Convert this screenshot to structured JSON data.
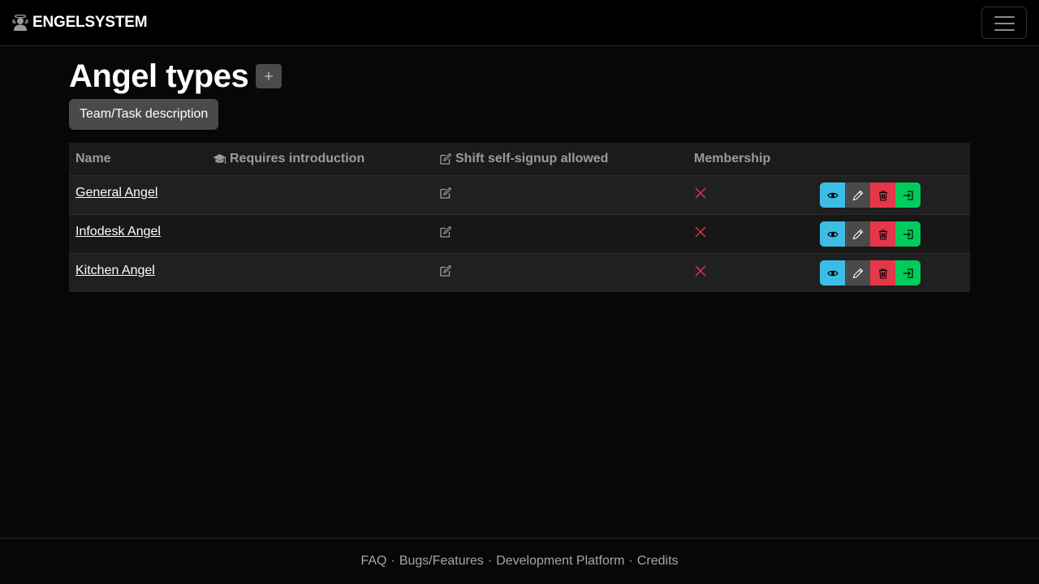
{
  "brand": {
    "name": "ENGELSYSTEM",
    "icon": "angel-icon"
  },
  "nav": {
    "toggler_icon": "hamburger-icon"
  },
  "page": {
    "title": "Angel types",
    "add_icon": "plus-icon",
    "description_button": "Team/Task description"
  },
  "table": {
    "columns": [
      {
        "label": "Name",
        "icon": ""
      },
      {
        "label": "Requires introduction",
        "icon": "graduation-cap-icon"
      },
      {
        "label": "Shift self-signup allowed",
        "icon": "pencil-square-icon"
      },
      {
        "label": "Membership",
        "icon": ""
      }
    ],
    "rows": [
      {
        "name": "General Angel",
        "requires_introduction": "",
        "self_signup_icon": "pencil-square-icon",
        "membership_icon": "x-icon"
      },
      {
        "name": "Infodesk Angel",
        "requires_introduction": "",
        "self_signup_icon": "pencil-square-icon",
        "membership_icon": "x-icon"
      },
      {
        "name": "Kitchen Angel",
        "requires_introduction": "",
        "self_signup_icon": "pencil-square-icon",
        "membership_icon": "x-icon"
      }
    ],
    "actions": [
      "eye-icon",
      "pencil-icon",
      "trash-icon",
      "sign-in-icon"
    ]
  },
  "footer": {
    "links": [
      "FAQ",
      "Bugs/Features",
      "Development Platform",
      "Credits"
    ],
    "separator": "·"
  },
  "colors": {
    "background": "#070707",
    "navbar": "#000000",
    "view": "#3dbde6",
    "edit": "#4a4a4a",
    "delete": "#e5364a",
    "join": "#00cc5c",
    "membership_x": "#e5364a"
  }
}
